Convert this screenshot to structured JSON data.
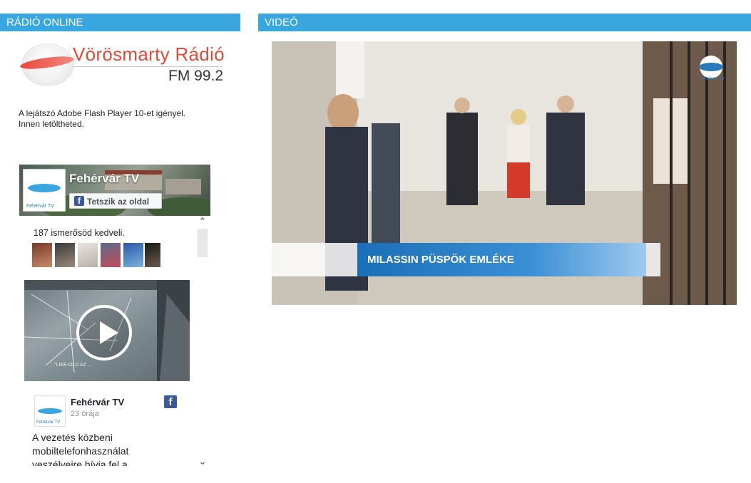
{
  "radio": {
    "header": "RÁDIÓ ONLINE",
    "station_name": "Vörösmarty Rádió",
    "frequency": "FM 99.2",
    "flash_note_line1": "A lejátszó Adobe Flash Player 10-et igényel.",
    "flash_note_line2": "Innen letöltheted."
  },
  "facebook": {
    "page_name": "Fehérvár TV",
    "avatar_text": "Fehérvár TV",
    "like_button": "Tetszik az oldal",
    "friends_like": "187 ismerősöd kedveli.",
    "video_caption": "\"LIKE-OLD AZ ...",
    "post": {
      "author": "Fehérvár TV",
      "time": "23 órája",
      "text_line1": "A vezetés közbeni",
      "text_line2": "mobiltelefonhasználat",
      "text_line3": "veszélyeire hívja fel a"
    }
  },
  "video": {
    "header": "VIDEÓ",
    "chyron": "MILASSIN PÜSPÖK EMLÉKE",
    "logo_text": "Fehérvár TV"
  },
  "colors": {
    "accent": "#3aa6df",
    "radio_red": "#e04a3a",
    "facebook_blue": "#3b5998"
  },
  "icons": [
    "play-icon",
    "facebook-icon",
    "chevron-up-icon",
    "chevron-down-icon"
  ]
}
